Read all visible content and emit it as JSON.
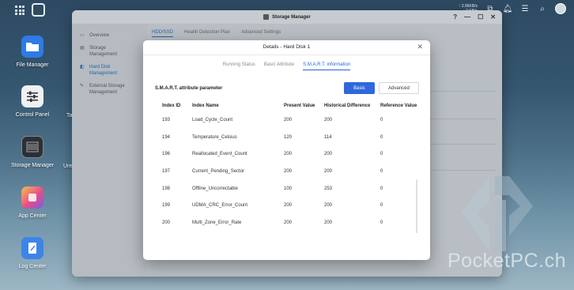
{
  "system_bar": {
    "net_up": "↑ 3.96KB/s",
    "net_down": "↓ 0 KB/s"
  },
  "desktop": {
    "icons": [
      {
        "label": "File Manager",
        "icon": "folder-icon",
        "color": "#2f7ae5"
      },
      {
        "label": "Control Panel",
        "icon": "sliders-icon",
        "color": "#eef1f4"
      },
      {
        "label": "Storage Manager",
        "icon": "storage-icon",
        "color": "#2b2f36"
      },
      {
        "label": "App Center",
        "icon": "app-center-icon",
        "color": "#e74c8b"
      },
      {
        "label": "Log Center",
        "icon": "log-icon",
        "color": "#3d84e6"
      }
    ],
    "partial_labels": [
      "Ta",
      "Ure"
    ]
  },
  "storage_window": {
    "title": "Storage Manager",
    "sidebar": [
      {
        "label": "Overview",
        "icon": "overview-icon"
      },
      {
        "label": "Storage Management",
        "icon": "storage-mgmt-icon"
      },
      {
        "label": "Hard Disk Management",
        "icon": "disk-icon",
        "active": true
      },
      {
        "label": "External Storage Management",
        "icon": "external-icon"
      }
    ],
    "tabs": [
      "HDD/SSD",
      "Health Detection Plan",
      "Advanced Settings"
    ]
  },
  "dialog": {
    "title": "Details - Hard Disk 1",
    "tabs": [
      {
        "label": "Running Status",
        "active": false
      },
      {
        "label": "Basic Attribute",
        "active": false
      },
      {
        "label": "S.M.A.R.T. information",
        "active": true
      }
    ],
    "section_title": "S.M.A.R.T. attribute parameter",
    "basic_label": "Basic",
    "advanced_label": "Advanced",
    "columns": [
      "Index ID",
      "Index Name",
      "Present Value",
      "Historical Difference",
      "Reference Value"
    ],
    "rows": [
      [
        "193",
        "Load_Cycle_Count",
        "200",
        "200",
        "0"
      ],
      [
        "194",
        "Temperature_Celsius",
        "120",
        "114",
        "0"
      ],
      [
        "196",
        "Reallocated_Event_Count",
        "200",
        "200",
        "0"
      ],
      [
        "197",
        "Current_Pending_Sector",
        "200",
        "200",
        "0"
      ],
      [
        "198",
        "Offline_Uncorrectable",
        "100",
        "253",
        "0"
      ],
      [
        "199",
        "UDMA_CRC_Error_Count",
        "200",
        "200",
        "0"
      ],
      [
        "200",
        "Multi_Zone_Error_Rate",
        "200",
        "200",
        "0"
      ]
    ]
  },
  "watermark": {
    "text": "PocketPC.ch"
  },
  "colors": {
    "accent": "#2f68dc",
    "active_tab": "#2566d8"
  }
}
